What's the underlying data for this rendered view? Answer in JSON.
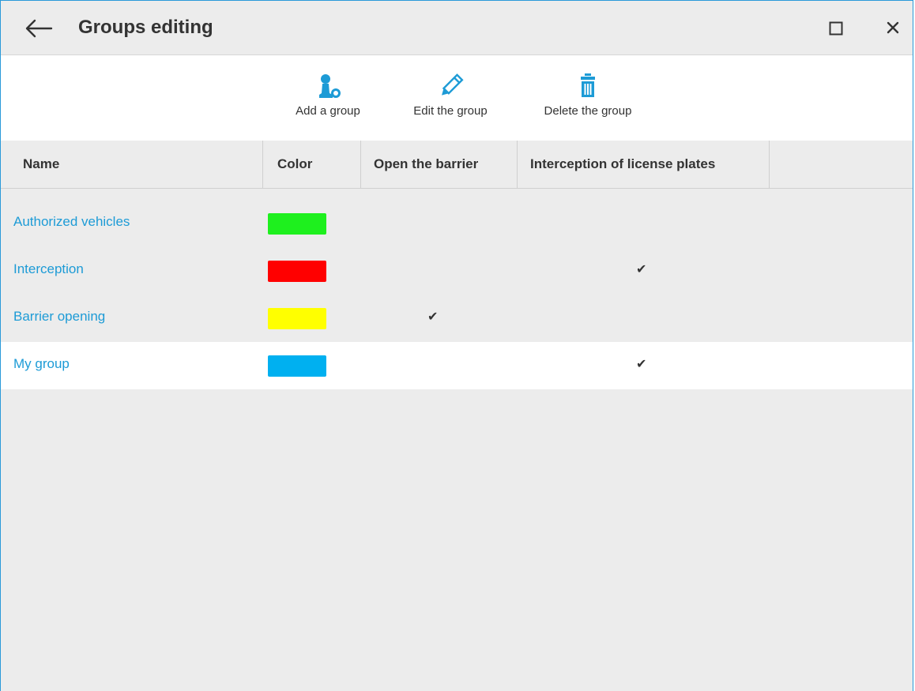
{
  "window": {
    "title": "Groups editing"
  },
  "toolbar": {
    "add_label": "Add a group",
    "edit_label": "Edit the group",
    "delete_label": "Delete the group"
  },
  "table": {
    "columns": [
      "Name",
      "Color",
      "Open the barrier",
      "Interception of license plates"
    ],
    "rows": [
      {
        "name": "Authorized vehicles",
        "color": "#1ef01e",
        "open_barrier": "",
        "interception": ""
      },
      {
        "name": "Interception",
        "color": "#ff0000",
        "open_barrier": "",
        "interception": "✔"
      },
      {
        "name": "Barrier opening",
        "color": "#ffff00",
        "open_barrier": "✔",
        "interception": ""
      },
      {
        "name": "My group",
        "color": "#00b0f0",
        "open_barrier": "",
        "interception": "✔"
      }
    ],
    "selected_row": "My group"
  },
  "colors": {
    "accent": "#1d9bd6",
    "background": "#ececec",
    "border": "#2a9ad9"
  }
}
